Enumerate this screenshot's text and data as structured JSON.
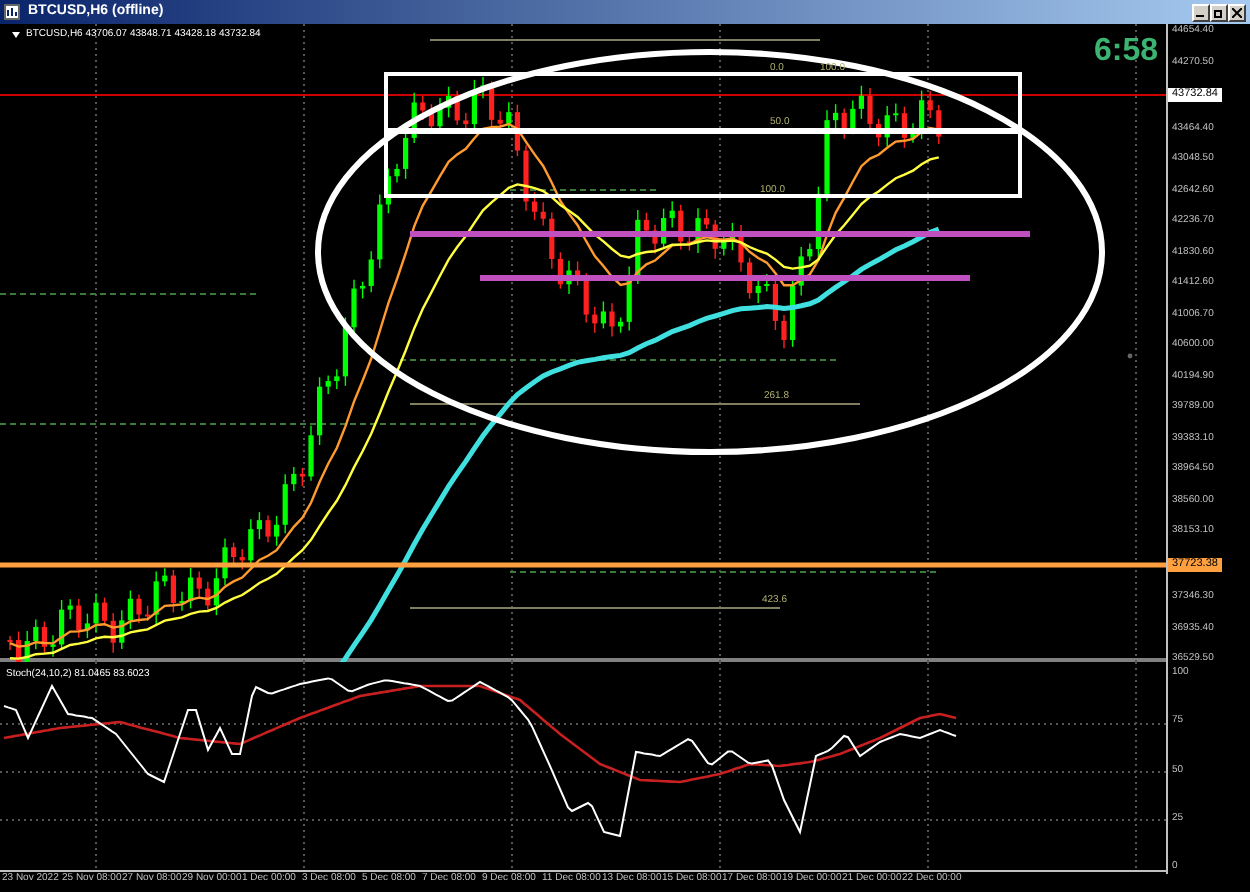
{
  "window": {
    "title": "BTCUSD,H6 (offline)"
  },
  "chart": {
    "symbol_info": "BTCUSD,H6  43706.07 43848.71 43428.18 43732.84",
    "timer": "6:58",
    "price_axis": [
      "44654.40",
      "44270.50",
      "43464.40",
      "43048.50",
      "42642.60",
      "42236.70",
      "41830.60",
      "41412.60",
      "41006.70",
      "40600.00",
      "40194.90",
      "39789.00",
      "39383.10",
      "38964.50",
      "38560.00",
      "38153.10",
      "37346.30",
      "36935.40",
      "36529.50"
    ],
    "current_price": "43732.84",
    "line_price": "37723.38",
    "fib_labels": [
      "0.0",
      "100.0",
      "50.0",
      "100.0",
      "261.8",
      "423.6"
    ]
  },
  "indicator": {
    "label": "Stoch(24,10,2) 81.0465 83.6023",
    "axis": [
      "100",
      "75",
      "50",
      "25",
      "0"
    ]
  },
  "time_axis": [
    "23 Nov 2022",
    "25 Nov 08:00",
    "27 Nov 08:00",
    "29 Nov 00:00",
    "1 Dec 00:00",
    "3 Dec 08:00",
    "5 Dec 08:00",
    "7 Dec 08:00",
    "9 Dec 08:00",
    "11 Dec 08:00",
    "13 Dec 08:00",
    "15 Dec 08:00",
    "17 Dec 08:00",
    "19 Dec 00:00",
    "21 Dec 00:00",
    "22 Dec 00:00"
  ]
}
